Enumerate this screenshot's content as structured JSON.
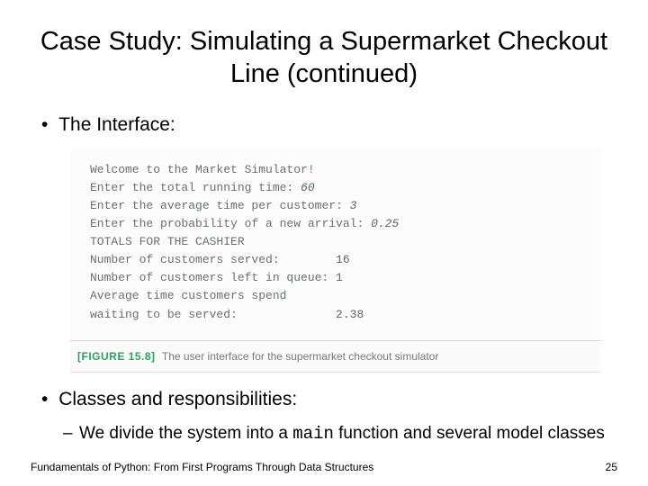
{
  "title": "Case Study: Simulating a Supermarket Checkout Line (continued)",
  "bullets": {
    "interface": "The Interface:",
    "classes": "Classes and responsibilities:",
    "sub_prefix": "We divide the system into a ",
    "sub_code": "main",
    "sub_suffix": " function and several model classes"
  },
  "terminal": {
    "welcome": "Welcome to the Market Simulator!",
    "row1_label": "Enter the total running time: ",
    "row1_val": "60",
    "row2_label": "Enter the average time per customer: ",
    "row2_val": "3",
    "row3_label": "Enter the probability of a new arrival: ",
    "row3_val": "0.25",
    "totals": "TOTALS FOR THE CASHIER",
    "served_label": "Number of customers served:        ",
    "served_val": "16",
    "left_label": "Number of customers left in queue: ",
    "left_val": "1",
    "avg_line1": "Average time customers spend",
    "avg_line2_label": "waiting to be served:              ",
    "avg_line2_val": "2.38"
  },
  "figure": {
    "tag": "[FIGURE 15.8]",
    "caption": "The user interface for the supermarket checkout simulator"
  },
  "footer": {
    "text": "Fundamentals of Python: From First Programs Through Data Structures",
    "page": "25"
  }
}
